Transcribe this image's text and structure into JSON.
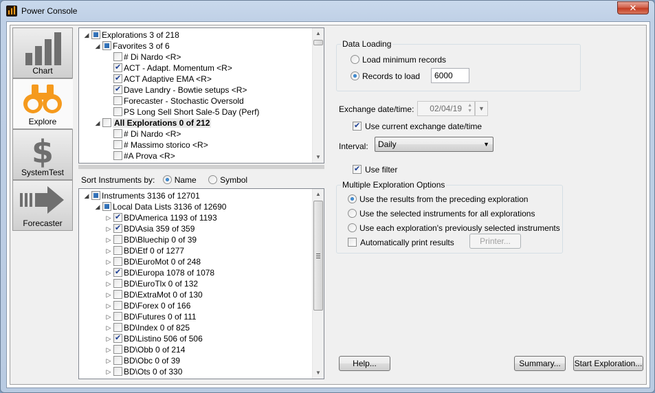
{
  "window": {
    "title": "Power Console",
    "close_label": "✕"
  },
  "nav": [
    {
      "label": "Chart",
      "icon": "bar-chart-icon",
      "active": false
    },
    {
      "label": "Explore",
      "icon": "binoculars-icon",
      "active": true
    },
    {
      "label": "SystemTest",
      "icon": "dollar-icon",
      "active": false
    },
    {
      "label": "Forecaster",
      "icon": "arrow-icon",
      "active": false
    }
  ],
  "explorations_tree": [
    {
      "label": "Explorations  3 of 218",
      "level": 0,
      "expander": "◢",
      "check": "partial",
      "bold": false
    },
    {
      "label": "Favorites  3 of 6",
      "level": 1,
      "expander": "◢",
      "check": "partial",
      "bold": false
    },
    {
      "label": "# Di Nardo <R>",
      "level": 2,
      "expander": "",
      "check": "none",
      "bold": false
    },
    {
      "label": "ACT - Adapt. Momentum <R>",
      "level": 2,
      "expander": "",
      "check": "checked",
      "bold": false
    },
    {
      "label": "ACT Adaptive EMA <R>",
      "level": 2,
      "expander": "",
      "check": "checked",
      "bold": false
    },
    {
      "label": "Dave Landry - Bowtie setups <R>",
      "level": 2,
      "expander": "",
      "check": "checked",
      "bold": false
    },
    {
      "label": "Forecaster - Stochastic Oversold",
      "level": 2,
      "expander": "",
      "check": "none",
      "bold": false
    },
    {
      "label": "PS Long Sell Short Sale-5 Day (Perf)",
      "level": 2,
      "expander": "",
      "check": "none",
      "bold": false
    },
    {
      "label": "All Explorations  0 of 212",
      "level": 1,
      "expander": "◢",
      "check": "none",
      "bold": true
    },
    {
      "label": "# Di Nardo <R>",
      "level": 2,
      "expander": "",
      "check": "none",
      "bold": false
    },
    {
      "label": "# Massimo storico <R>",
      "level": 2,
      "expander": "",
      "check": "none",
      "bold": false
    },
    {
      "label": "#A Prova <R>",
      "level": 2,
      "expander": "",
      "check": "none",
      "bold": false
    }
  ],
  "sort": {
    "label": "Sort Instruments by:",
    "options": [
      "Name",
      "Symbol"
    ],
    "selected": "Name"
  },
  "instruments_tree": [
    {
      "label": "Instruments  3136 of 12701",
      "level": 0,
      "expander": "◢",
      "check": "partial"
    },
    {
      "label": "Local Data Lists  3136 of 12690",
      "level": 1,
      "expander": "◢",
      "check": "partial"
    },
    {
      "label": "BD\\America  1193 of 1193",
      "level": 2,
      "expander": "▷",
      "check": "checked"
    },
    {
      "label": "BD\\Asia  359 of 359",
      "level": 2,
      "expander": "▷",
      "check": "checked"
    },
    {
      "label": "BD\\Bluechip  0 of 39",
      "level": 2,
      "expander": "▷",
      "check": "none"
    },
    {
      "label": "BD\\Etf  0 of 1277",
      "level": 2,
      "expander": "▷",
      "check": "none"
    },
    {
      "label": "BD\\EuroMot  0 of 248",
      "level": 2,
      "expander": "▷",
      "check": "none"
    },
    {
      "label": "BD\\Europa  1078 of 1078",
      "level": 2,
      "expander": "▷",
      "check": "checked"
    },
    {
      "label": "BD\\EuroTlx  0 of 132",
      "level": 2,
      "expander": "▷",
      "check": "none"
    },
    {
      "label": "BD\\ExtraMot  0 of 130",
      "level": 2,
      "expander": "▷",
      "check": "none"
    },
    {
      "label": "BD\\Forex  0 of 166",
      "level": 2,
      "expander": "▷",
      "check": "none"
    },
    {
      "label": "BD\\Futures  0 of 111",
      "level": 2,
      "expander": "▷",
      "check": "none"
    },
    {
      "label": "BD\\Index  0 of 825",
      "level": 2,
      "expander": "▷",
      "check": "none"
    },
    {
      "label": "BD\\Listino  506 of 506",
      "level": 2,
      "expander": "▷",
      "check": "checked"
    },
    {
      "label": "BD\\Obb  0 of 214",
      "level": 2,
      "expander": "▷",
      "check": "none"
    },
    {
      "label": "BD\\Obc  0 of 39",
      "level": 2,
      "expander": "▷",
      "check": "none"
    },
    {
      "label": "BD\\Ots  0 of 330",
      "level": 2,
      "expander": "▷",
      "check": "none"
    }
  ],
  "data_loading": {
    "title": "Data Loading",
    "option_min": "Load minimum records",
    "option_records": "Records to load",
    "selected": "records",
    "records_value": "6000"
  },
  "exchange": {
    "label": "Exchange date/time:",
    "date_value": "02/04/19",
    "use_current_label": "Use current exchange date/time",
    "use_current_checked": true
  },
  "interval": {
    "label": "Interval:",
    "value": "Daily"
  },
  "filter": {
    "label": "Use filter",
    "checked": true
  },
  "multi": {
    "title": "Multiple Exploration Options",
    "options": [
      "Use the results from the preceding exploration",
      "Use the selected instruments for all explorations",
      "Use each exploration's previously selected instruments"
    ],
    "selected_index": 0,
    "print_label": "Automatically print results",
    "print_checked": false,
    "printer_button": "Printer..."
  },
  "buttons": {
    "help": "Help...",
    "summary": "Summary...",
    "start": "Start Exploration..."
  }
}
